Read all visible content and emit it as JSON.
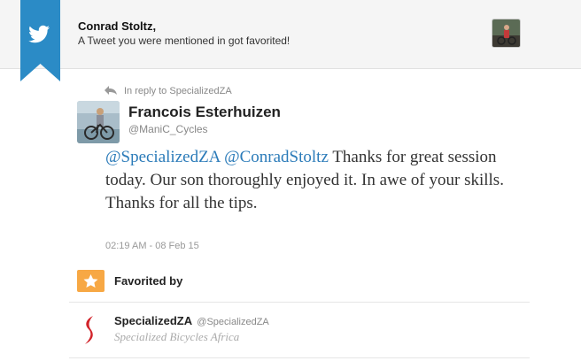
{
  "header": {
    "recipient": "Conrad Stoltz,",
    "notice": "A Tweet you were mentioned in got favorited!"
  },
  "tweet": {
    "reply_context": "In reply to SpecializedZA",
    "author_name": "Francois Esterhuizen",
    "author_handle": "@ManiC_Cycles",
    "mention_1": "@SpecializedZA",
    "mention_2": "@ConradStoltz",
    "text_body": "Thanks for great session today. Our son thoroughly enjoyed it. In awe of your skills. Thanks for all the tips.",
    "timestamp": "02:19 AM - 08 Feb 15"
  },
  "favorites": {
    "label": "Favorited by",
    "user_name": "SpecializedZA",
    "user_handle": "@SpecializedZA",
    "user_bio": "Specialized Bicycles Africa"
  },
  "colors": {
    "brand_blue": "#2b7bb9",
    "favorite_orange": "#f7a844"
  },
  "icons": {
    "ribbon": "twitter-bird-icon",
    "reply": "reply-arrow-icon",
    "favorite": "star-icon",
    "specialized_logo": "specialized-s-logo-icon"
  }
}
